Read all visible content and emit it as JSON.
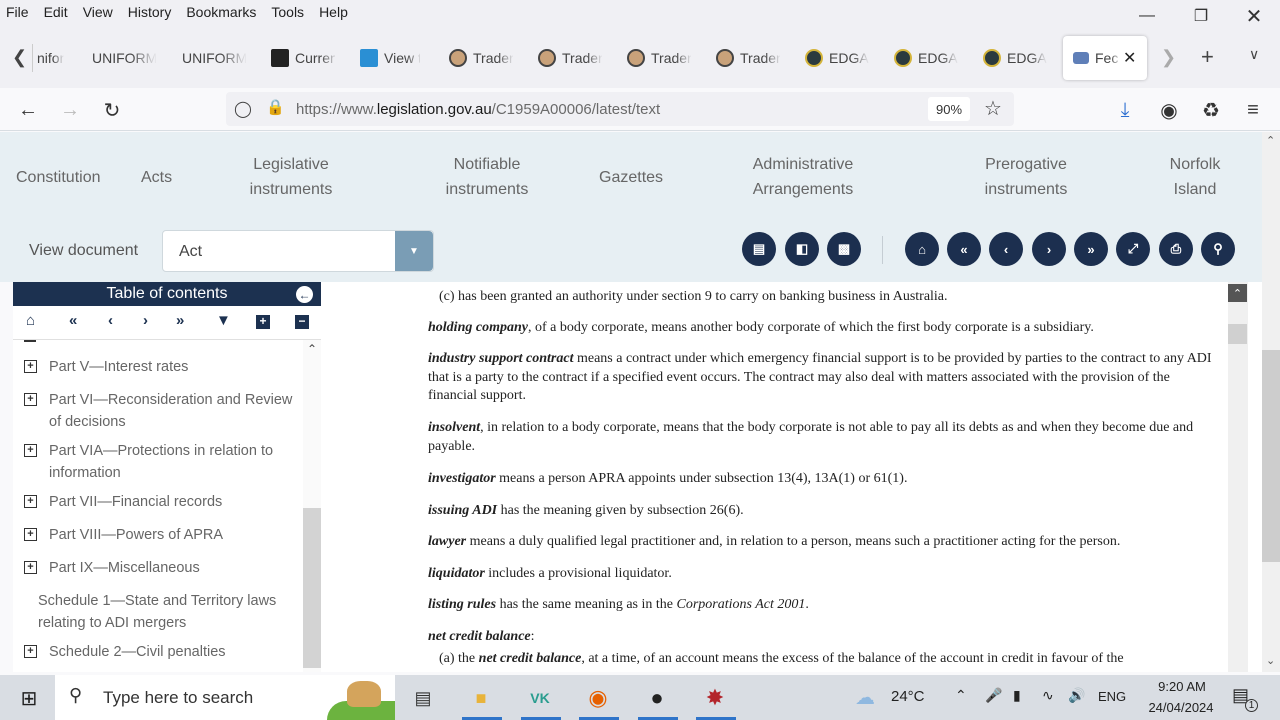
{
  "menu": [
    "File",
    "Edit",
    "View",
    "History",
    "Bookmarks",
    "Tools",
    "Help"
  ],
  "tabs": [
    {
      "label": "nifor",
      "icon": "none"
    },
    {
      "label": "UNIFORM",
      "icon": "none"
    },
    {
      "label": "UNIFORM",
      "icon": "none"
    },
    {
      "label": "Curren",
      "icon": "aim-favicon"
    },
    {
      "label": "View t",
      "icon": "view-favicon"
    },
    {
      "label": "Trader",
      "icon": "trader-favicon"
    },
    {
      "label": "Trader",
      "icon": "trader-favicon"
    },
    {
      "label": "Trader",
      "icon": "trader-favicon"
    },
    {
      "label": "Trader",
      "icon": "trader-favicon"
    },
    {
      "label": "EDGA",
      "icon": "edgar-favicon"
    },
    {
      "label": "EDGA",
      "icon": "edgar-favicon"
    },
    {
      "label": "EDGA",
      "icon": "edgar-favicon"
    },
    {
      "label": "Fec",
      "icon": "federal-register-favicon",
      "active": true
    }
  ],
  "browser": {
    "url_prefix": "https://www.",
    "url_domain": "legislation.gov.au",
    "url_path": "/C1959A00006/latest/text",
    "zoom": "90%"
  },
  "site_nav": [
    "Constitution",
    "Acts",
    "Legislative instruments",
    "Notifiable instruments",
    "Gazettes",
    "Administrative Arrangements",
    "Prerogative instruments",
    "Norfolk Island"
  ],
  "view_document": {
    "label": "View document",
    "selected": "Act"
  },
  "toc": {
    "title": "Table of contents",
    "items": [
      {
        "label": "Part V—Interest rates",
        "expandable": true
      },
      {
        "label": "Part VI—Reconsideration and Review of decisions",
        "expandable": true
      },
      {
        "label": "Part VIA—Protections in relation to information",
        "expandable": true
      },
      {
        "label": "Part VII—Financial records",
        "expandable": true
      },
      {
        "label": "Part VIII—Powers of APRA",
        "expandable": true
      },
      {
        "label": "Part IX—Miscellaneous",
        "expandable": true
      },
      {
        "label": "Schedule 1—State and Territory laws relating to ADI mergers",
        "expandable": false
      },
      {
        "label": "Schedule 2—Civil penalties",
        "expandable": true
      }
    ]
  },
  "document": {
    "paragraphs": [
      {
        "term": "",
        "text": "(c)  has been granted an authority under section 9 to carry on banking business in Australia."
      },
      {
        "term": "holding company",
        "text": ", of a body corporate, means another body corporate of which the first body corporate is a subsidiary."
      },
      {
        "term": "industry support contract",
        "text": " means a contract under which emergency financial support is to be provided by parties to the contract to any ADI that is a party to the contract if a specified event occurs. The contract may also deal with matters associated with the provision of the financial support."
      },
      {
        "term": "insolvent",
        "text": ", in relation to a body corporate, means that the body corporate is not able to pay all its debts as and when they become due and payable."
      },
      {
        "term": "investigator",
        "text": " means a person APRA appoints under subsection 13(4), 13A(1) or 61(1)."
      },
      {
        "term": "issuing ADI",
        "text": " has the meaning given by subsection 26(6)."
      },
      {
        "term": "lawyer",
        "text": " means a duly qualified legal practitioner and, in relation to a person, means such a practitioner acting for the person."
      },
      {
        "term": "liquidator",
        "text": " includes a provisional liquidator."
      },
      {
        "term": "listing rules",
        "text": " has the same meaning as in the ",
        "italic": "Corporations Act 2001",
        "after": "."
      },
      {
        "term": "net credit balance",
        "text": ":"
      },
      {
        "term": "",
        "text": "(a)  the ",
        "term2": "net credit balance",
        "after": ", at a time, of an account means the excess of the balance of the account in credit in favour of the"
      }
    ]
  },
  "taskbar": {
    "search_placeholder": "Type here to search",
    "weather": "24°C",
    "language": "ENG",
    "time": "9:20 AM",
    "date": "24/04/2024",
    "notifications": "1"
  }
}
